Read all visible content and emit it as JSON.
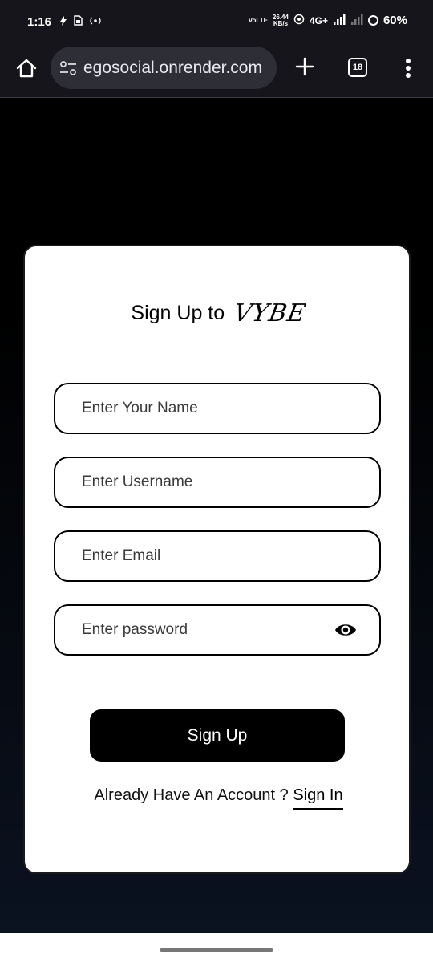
{
  "status_bar": {
    "time": "1:16",
    "left_icons": [
      "bolt-icon",
      "sim-icon",
      "hotspot-icon"
    ],
    "volte_label": "VoLTE",
    "network_speed_value": "26.44",
    "network_speed_unit": "KB/s",
    "network_type": "4G+",
    "battery": "60%"
  },
  "browser": {
    "url": "egosocial.onrender.com",
    "tab_count": "18"
  },
  "form": {
    "title": "Sign Up to",
    "brand": "VYBE",
    "name_placeholder": "Enter Your Name",
    "username_placeholder": "Enter Username",
    "email_placeholder": "Enter Email",
    "password_placeholder": "Enter password",
    "submit_label": "Sign Up",
    "account_prompt": "Already Have An Account ? ",
    "signin_label": "Sign In"
  },
  "colors": {
    "card_background": "#ffffff",
    "page_background": "#000000",
    "button_background": "#000000",
    "browser_bar": "#15151b"
  }
}
